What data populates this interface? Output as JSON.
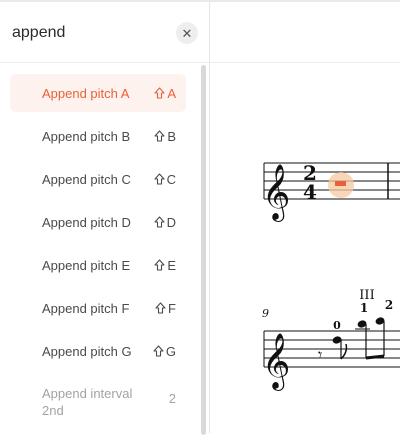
{
  "search": {
    "value": "append"
  },
  "commands": [
    {
      "label": "Append pitch A",
      "key": "A",
      "shift": true,
      "active": true,
      "enabled": true
    },
    {
      "label": "Append pitch B",
      "key": "B",
      "shift": true,
      "active": false,
      "enabled": true
    },
    {
      "label": "Append pitch C",
      "key": "C",
      "shift": true,
      "active": false,
      "enabled": true
    },
    {
      "label": "Append pitch D",
      "key": "D",
      "shift": true,
      "active": false,
      "enabled": true
    },
    {
      "label": "Append pitch E",
      "key": "E",
      "shift": true,
      "active": false,
      "enabled": true
    },
    {
      "label": "Append pitch F",
      "key": "F",
      "shift": true,
      "active": false,
      "enabled": true
    },
    {
      "label": "Append pitch G",
      "key": "G",
      "shift": true,
      "active": false,
      "enabled": true
    },
    {
      "label": "Append interval 2nd",
      "key": "2",
      "shift": false,
      "active": false,
      "enabled": false
    }
  ],
  "score": {
    "time_signature": {
      "top": "2",
      "bottom": "4"
    },
    "measure_number": "9",
    "position_label": "III",
    "fingerings": [
      "0",
      "1",
      "2"
    ]
  },
  "colors": {
    "accent": "#e8613a",
    "active_bg": "#fdf2ee",
    "cursor_glow": "#f6c9a0"
  },
  "icons": {
    "shift": "shift-arrow-icon",
    "clear": "close-icon"
  }
}
